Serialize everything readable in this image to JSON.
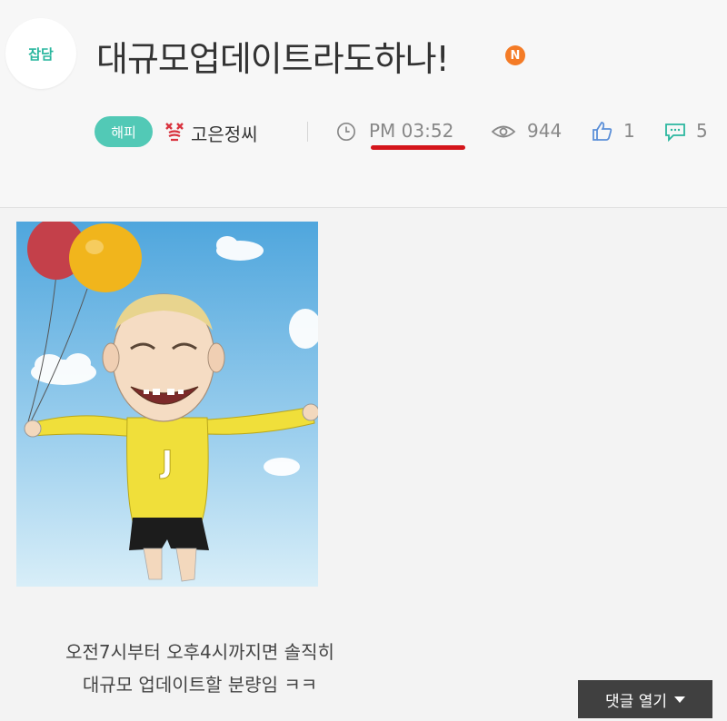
{
  "board": {
    "badge_label": "잡담"
  },
  "post": {
    "title": "대규모업데이트라도하나!",
    "new_badge": "N",
    "level": "해피",
    "author": "고은정씨",
    "time": "PM 03:52",
    "views": "944",
    "likes": "1",
    "comments": "5",
    "body_lines": [
      "오전7시부터 오후4시까지면 솔직히",
      "대규모 업데이트할 분량임 ㅋㅋ"
    ]
  },
  "actions": {
    "comment_toggle": "댓글 열기"
  },
  "colors": {
    "accent": "#52c9b6",
    "new_badge": "#f47b26",
    "annotation_underline": "#d4151b",
    "toggle_bg": "#404040"
  },
  "icons": [
    "clock-icon",
    "eye-icon",
    "thumbs-up-icon",
    "comment-icon",
    "chevron-down-icon"
  ]
}
